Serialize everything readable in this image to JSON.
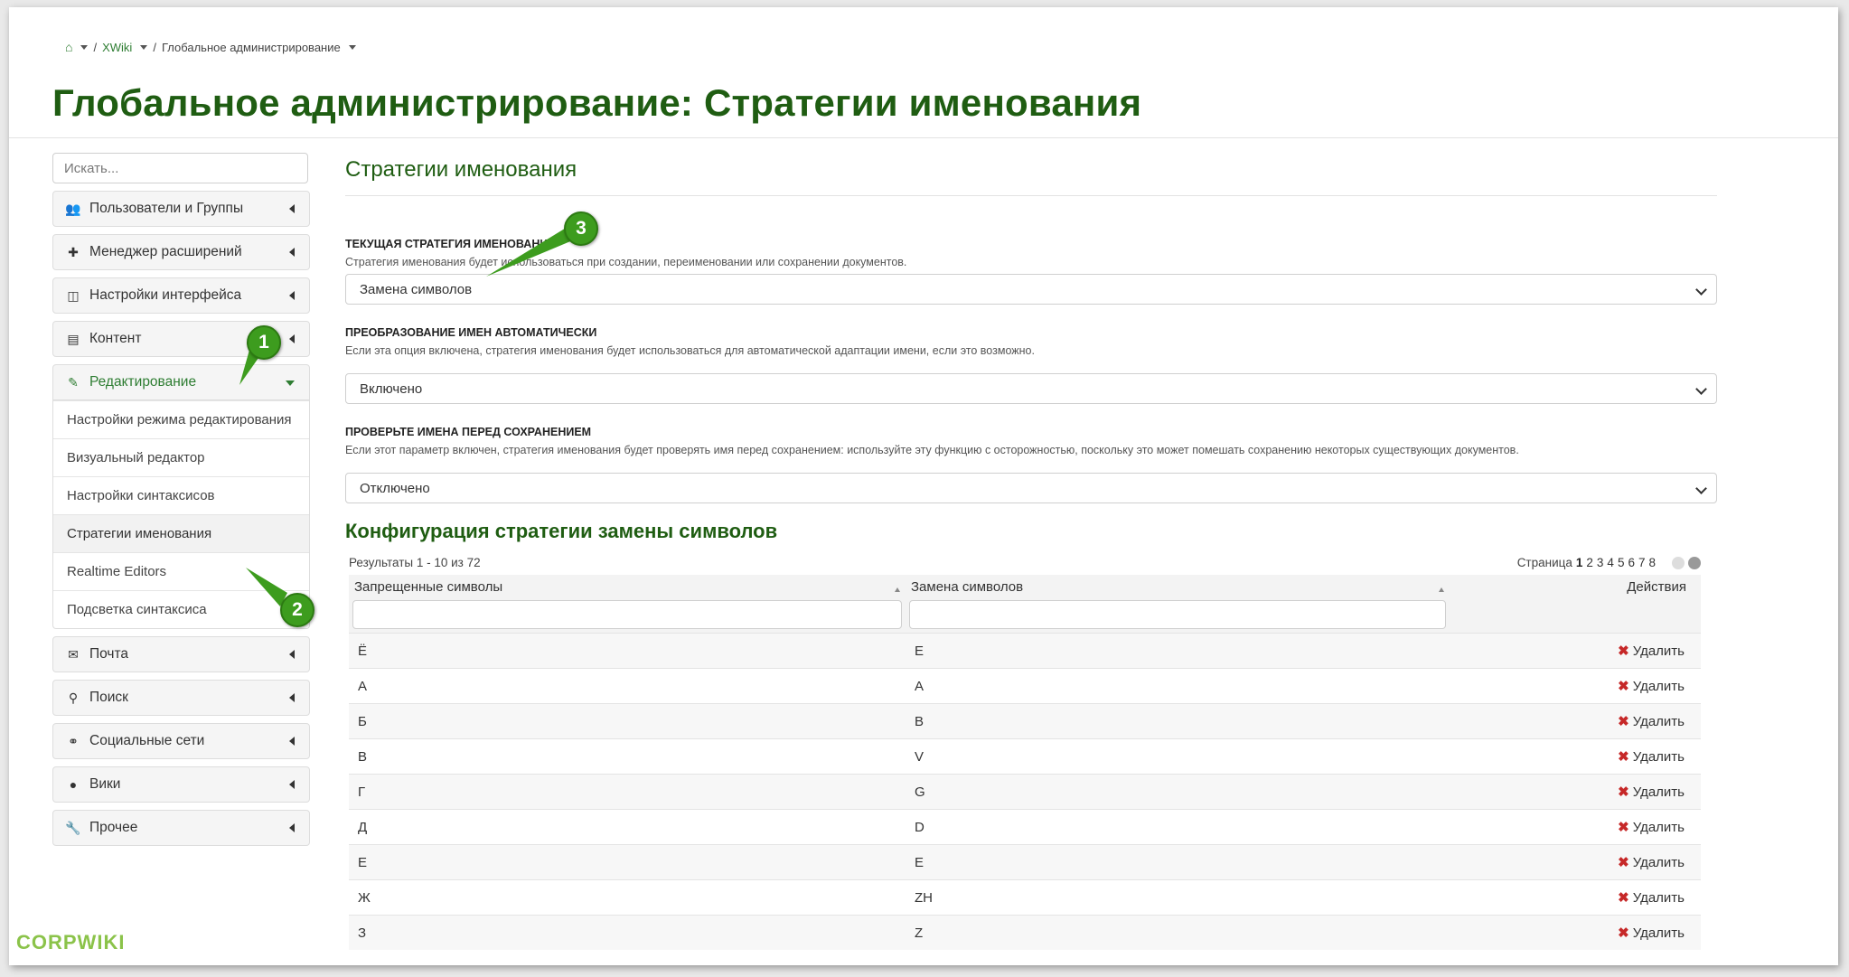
{
  "breadcrumb": {
    "home_icon": "home-icon",
    "items": [
      "XWiki",
      "Глобальное администрирование"
    ]
  },
  "page_title": "Глобальное администрирование: Стратегии именования",
  "sidebar": {
    "search_placeholder": "Искать...",
    "sections": [
      {
        "icon": "users-icon",
        "label": "Пользователи и Группы"
      },
      {
        "icon": "puzzle-icon",
        "label": "Менеджер расширений"
      },
      {
        "icon": "layout-icon",
        "label": "Настройки интерфейса"
      },
      {
        "icon": "document-icon",
        "label": "Контент"
      },
      {
        "icon": "pencil-icon",
        "label": "Редактирование",
        "expanded": true
      }
    ],
    "editing_items": [
      "Настройки режима редактирования",
      "Визуальный редактор",
      "Настройки синтаксисов",
      "Стратегии именования",
      "Realtime Editors",
      "Подсветка синтаксиса"
    ],
    "sections_after": [
      {
        "icon": "mail-icon",
        "label": "Почта"
      },
      {
        "icon": "search-icon",
        "label": "Поиск"
      },
      {
        "icon": "link-icon",
        "label": "Социальные сети"
      },
      {
        "icon": "globe-icon",
        "label": "Вики"
      },
      {
        "icon": "wrench-icon",
        "label": "Прочее"
      }
    ]
  },
  "main": {
    "section_title": "Стратегии именования",
    "fields": [
      {
        "label": "ТЕКУЩАЯ СТРАТЕГИЯ ИМЕНОВАНИЯ",
        "hint": "Стратегия именования будет использоваться при создании, переименовании или сохранении документов.",
        "value": "Замена символов"
      },
      {
        "label": "ПРЕОБРАЗОВАНИЕ ИМЕН АВТОМАТИЧЕСКИ",
        "hint": "Если эта опция включена, стратегия именования будет использоваться для автоматической адаптации имени, если это возможно.",
        "value": "Включено"
      },
      {
        "label": "ПРОВЕРЬТЕ ИМЕНА ПЕРЕД СОХРАНЕНИЕМ",
        "hint": "Если этот параметр включен, стратегия именования будет проверять имя перед сохранением: используйте эту функцию с осторожностью, поскольку это может помешать сохранению некоторых существующих документов.",
        "value": "Отключено"
      }
    ],
    "config_title": "Конфигурация стратегии замены символов",
    "results_text": "Результаты 1 - 10 из 72",
    "pager": {
      "label": "Страница",
      "current": "1",
      "pages": [
        "2",
        "3",
        "4",
        "5",
        "6",
        "7",
        "8"
      ]
    },
    "table": {
      "headers": [
        "Запрещенные символы",
        "Замена символов",
        "Действия"
      ],
      "delete_label": "Удалить",
      "rows": [
        [
          "Ё",
          "E"
        ],
        [
          "А",
          "A"
        ],
        [
          "Б",
          "B"
        ],
        [
          "В",
          "V"
        ],
        [
          "Г",
          "G"
        ],
        [
          "Д",
          "D"
        ],
        [
          "Е",
          "E"
        ],
        [
          "Ж",
          "ZH"
        ],
        [
          "З",
          "Z"
        ]
      ]
    }
  },
  "callouts": [
    "1",
    "2",
    "3"
  ],
  "watermark": "CORPWIKI",
  "colors": {
    "accent_green": "#1f5d12",
    "link_green": "#2e7d32",
    "delete_red": "#c62828",
    "badge_green": "#3d9c1e"
  }
}
